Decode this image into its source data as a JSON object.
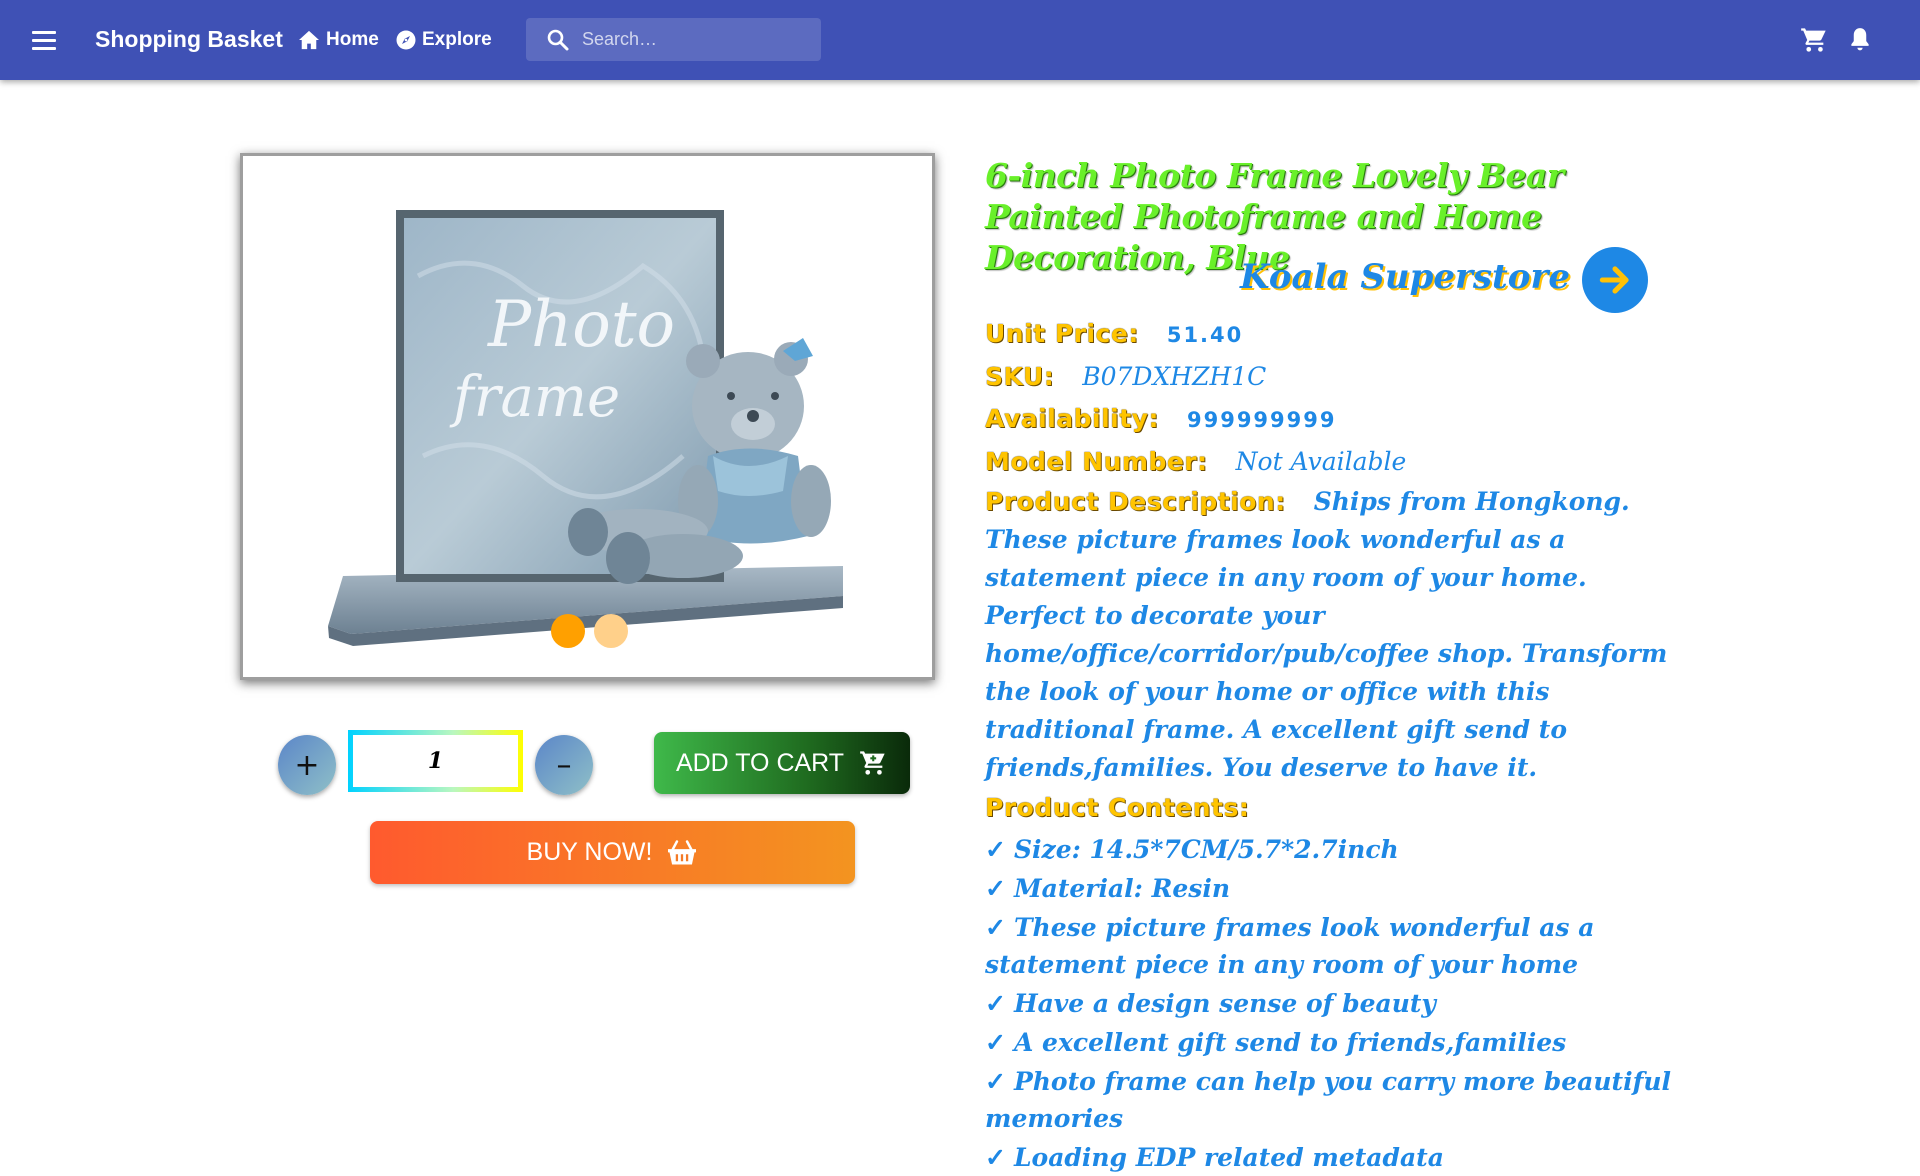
{
  "header": {
    "app_title": "Shopping Basket",
    "nav": [
      {
        "label": "Home",
        "icon": "home-icon"
      },
      {
        "label": "Explore",
        "icon": "compass-icon"
      }
    ],
    "search_placeholder": "Search…",
    "right_icons": [
      "cart-icon",
      "bell-icon"
    ],
    "color": "#3f51b5"
  },
  "product": {
    "title": "6-inch Photo Frame Lovely Bear Painted Photoframe and Home Decoration, Blue",
    "store": "Koala Superstore",
    "unit_price_label": "Unit Price:",
    "unit_price": "51.40",
    "sku_label": "SKU:",
    "sku": "B07DXHZH1C",
    "availability_label": "Availability:",
    "availability": "999999999",
    "model_label": "Model Number:",
    "model": "Not Available",
    "description_label": "Product Description:",
    "description": "Ships from Hongkong. These picture frames look wonderful as a statement piece in any room of your home. Perfect to decorate your home/office/corridor/pub/coffee shop. Transform the look of your home or office with this traditional frame. A excellent gift send to friends,families. You deserve to have it.",
    "contents_label": "Product Contents:",
    "contents": [
      "Size: 14.5*7CM/5.7*2.7inch",
      "Material: Resin",
      "These picture frames look wonderful as a statement piece in any room of your home",
      "Have a design sense of beauty",
      "A excellent gift send to friends,families",
      "Photo frame can help you carry more beautiful memories",
      "Loading EDP related metadata"
    ],
    "image": {
      "frame_text_1": "Photo",
      "frame_text_2": "frame",
      "carousel_slides": 2,
      "active_slide": 1
    }
  },
  "purchase": {
    "plus": "+",
    "minus": "–",
    "quantity": "1",
    "add_to_cart": "ADD TO CART",
    "buy_now": "BUY NOW!"
  }
}
